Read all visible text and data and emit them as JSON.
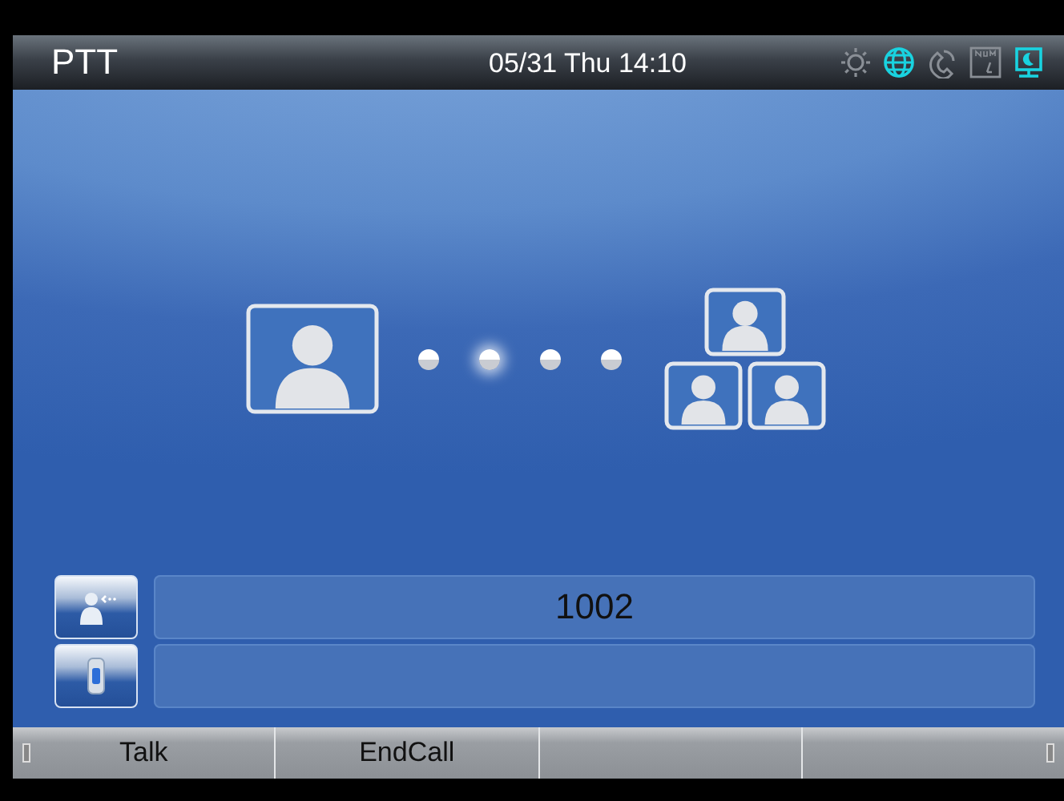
{
  "status_bar": {
    "title": "PTT",
    "datetime": "05/31 Thu 14:10",
    "icons": [
      {
        "kind": "sun",
        "on": false
      },
      {
        "kind": "globe",
        "on": true
      },
      {
        "kind": "handset",
        "on": false
      },
      {
        "kind": "num",
        "on": false
      },
      {
        "kind": "monitor",
        "on": true
      }
    ]
  },
  "call_diagram": {
    "dots": [
      {
        "selected": false
      },
      {
        "selected": true
      },
      {
        "selected": false
      },
      {
        "selected": false
      }
    ]
  },
  "fields": [
    {
      "kind": "contact",
      "value": "1002"
    },
    {
      "kind": "phone"
    }
  ],
  "softkeys": [
    "Talk",
    "EndCall"
  ]
}
